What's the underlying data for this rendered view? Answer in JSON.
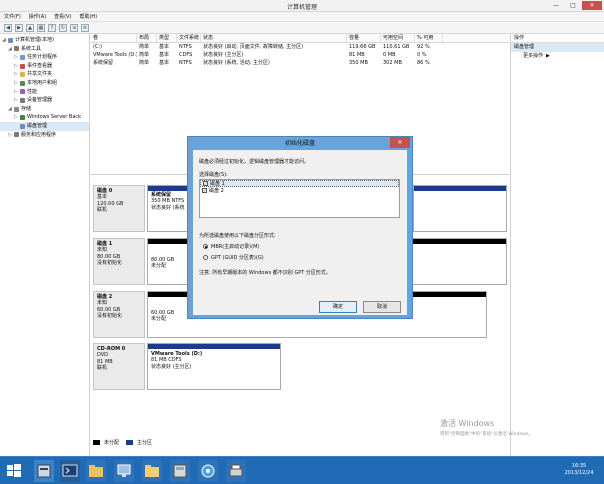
{
  "window": {
    "title": "计算机管理",
    "minimize": "—",
    "maximize": "□",
    "close": "✕"
  },
  "menu": [
    "文件(F)",
    "操作(A)",
    "查看(V)",
    "帮助(H)"
  ],
  "toolbar_icons": [
    "back-icon",
    "forward-icon",
    "up-folder-icon",
    "properties-icon",
    "help-icon",
    "refresh-icon",
    "export-icon",
    "settings-icon"
  ],
  "tree": [
    {
      "label": "计算机管理(本地)",
      "indent": 0,
      "icon": "computer-icon",
      "color": "#6b8fb8"
    },
    {
      "label": "系统工具",
      "indent": 1,
      "icon": "tools-icon",
      "color": "#8a7a55"
    },
    {
      "label": "任务计划程序",
      "indent": 2,
      "icon": "clock-icon",
      "color": "#6a9bd1"
    },
    {
      "label": "事件查看器",
      "indent": 2,
      "icon": "event-icon",
      "color": "#c9504a"
    },
    {
      "label": "共享文件夹",
      "indent": 2,
      "icon": "folder-icon",
      "color": "#d9b44a"
    },
    {
      "label": "本地用户和组",
      "indent": 2,
      "icon": "users-icon",
      "color": "#5a8a5a"
    },
    {
      "label": "性能",
      "indent": 2,
      "icon": "performance-icon",
      "color": "#9a5ab0"
    },
    {
      "label": "设备管理器",
      "indent": 2,
      "icon": "device-icon",
      "color": "#7a7a7a"
    },
    {
      "label": "存储",
      "indent": 1,
      "icon": "storage-icon",
      "color": "#8a8a8a"
    },
    {
      "label": "Windows Server Back",
      "indent": 2,
      "icon": "backup-icon",
      "color": "#3a8a3a"
    },
    {
      "label": "磁盘管理",
      "indent": 2,
      "icon": "disk-icon",
      "color": "#6b8fb8"
    },
    {
      "label": "服务和应用程序",
      "indent": 1,
      "icon": "services-icon",
      "color": "#7a7a7a"
    }
  ],
  "actions": {
    "header": "操作",
    "selected": "磁盘管理",
    "more": "更多操作",
    "more_arrow": "▶"
  },
  "volume_table": {
    "headers": [
      "卷",
      "布局",
      "类型",
      "文件系统",
      "状态",
      "容量",
      "可用空间",
      "% 可用"
    ],
    "rows": [
      [
        "(C:)",
        "简单",
        "基本",
        "NTFS",
        "状态良好 (启动, 页面文件, 故障转储, 主分区)",
        "119.66 GB",
        "110.61 GB",
        "92 %"
      ],
      [
        "VMware Tools (D:)",
        "简单",
        "基本",
        "CDFS",
        "状态良好 (主分区)",
        "81 MB",
        "0 MB",
        "0 %"
      ],
      [
        "系统保留",
        "简单",
        "基本",
        "NTFS",
        "状态良好 (系统, 活动, 主分区)",
        "350 MB",
        "302 MB",
        "86 %"
      ]
    ]
  },
  "disks": [
    {
      "name": "磁盘 0",
      "type": "基本",
      "size": "120.00 GB",
      "status": "联机",
      "part_title": "系统保留",
      "part_size": "350 MB NTFS",
      "part_status": "状态良好 (系统"
    },
    {
      "name": "磁盘 1",
      "type": "未知",
      "size": "80.00 GB",
      "status": "没有初始化",
      "part_size": "80.00 GB",
      "part_status": "未分配"
    },
    {
      "name": "磁盘 2",
      "type": "未知",
      "size": "60.00 GB",
      "status": "没有初始化",
      "part_size": "60.00 GB",
      "part_status": "未分配"
    },
    {
      "name": "CD-ROM 0",
      "type": "DVD",
      "size": "81 MB",
      "status": "联机",
      "part_title": "VMware Tools (D:)",
      "part_size": "81 MB CDFS",
      "part_status": "状态良好 (主分区)"
    }
  ],
  "legend": {
    "unallocated": "未分配",
    "primary": "主分区",
    "unallocated_color": "#000000",
    "primary_color": "#1a3a8a"
  },
  "dialog": {
    "title": "初始化磁盘",
    "close": "✕",
    "intro": "磁盘必须经过初始化，逻辑磁盘管理器才能访问。",
    "select_label": "选择磁盘(S):",
    "disks": [
      {
        "label": "磁盘 1",
        "checked": true
      },
      {
        "label": "磁盘 2",
        "checked": true
      }
    ],
    "style_label": "为所选磁盘使用以下磁盘分区形式:",
    "options": [
      {
        "label": "MBR(主启动记录)(M)",
        "selected": true
      },
      {
        "label": "GPT (GUID 分区表)(G)",
        "selected": false
      }
    ],
    "note": "注意: 所有早期版本的 Windows 都不识别 GPT 分区形式。",
    "ok": "确定",
    "cancel": "取消"
  },
  "watermark": {
    "line1": "激活 Windows",
    "line2": "转到\"控制面板\"中的\"系统\"以激活 Windows。"
  },
  "taskbar": {
    "time": "16:35",
    "date": "2013/12/24",
    "icons": [
      "start-icon",
      "server-manager-icon",
      "powershell-icon",
      "explorer-icon",
      "computer-management-icon",
      "folder-icon",
      "tools-icon",
      "network-icon",
      "printer-icon"
    ]
  },
  "colors": {
    "accent": "#1f6bb5",
    "selection": "#dbe9f5",
    "close": "#c75050",
    "dialog_frame": "#6aa3d8"
  }
}
